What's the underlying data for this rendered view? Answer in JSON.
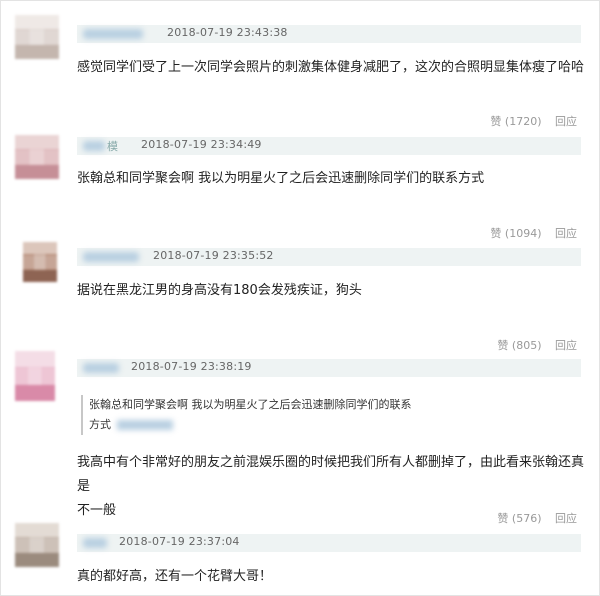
{
  "comments": [
    {
      "time": "2018-07-19 23:43:38",
      "text": "感觉同学们受了上一次同学会照片的刺激集体健身减肥了，这次的合照明显集体瘦了哈哈",
      "likes": "赞 (1720)",
      "reply": "回应",
      "avatar_colors": [
        "#cfc3be",
        "#e9e2df"
      ]
    },
    {
      "name_fragment": "模",
      "time": "2018-07-19 23:34:49",
      "text": "张翰总和同学聚会啊 我以为明星火了之后会迅速删除同学们的联系方式",
      "likes": "赞 (1094)",
      "reply": "回应",
      "avatar_colors": [
        "#d29aa2",
        "#e6c9c7"
      ]
    },
    {
      "time": "2018-07-19 23:35:52",
      "text": "据说在黑龙江男的身高没有180会发残疾证，狗头",
      "likes": "赞 (805)",
      "reply": "回应",
      "avatar_colors": [
        "#9d6f5a",
        "#cdb2a3"
      ]
    },
    {
      "time": "2018-07-19 23:38:19",
      "quote_line1": "张翰总和同学聚会啊 我以为明星火了之后会迅速删除同学们的联系",
      "quote_line2": "方式",
      "text_line1": "我高中有个非常好的朋友之前混娱乐圈的时候把我们所有人都删掉了，由此看来张翰还真是",
      "text_line2": "不一般",
      "likes": "赞 (576)",
      "reply": "回应",
      "avatar_colors": [
        "#e2a4bd",
        "#f0d6e1"
      ]
    },
    {
      "time": "2018-07-19 23:37:04",
      "text": "真的都好高，还有一个花臂大哥！",
      "avatar_colors": [
        "#a79788",
        "#d7ccc3"
      ]
    }
  ]
}
